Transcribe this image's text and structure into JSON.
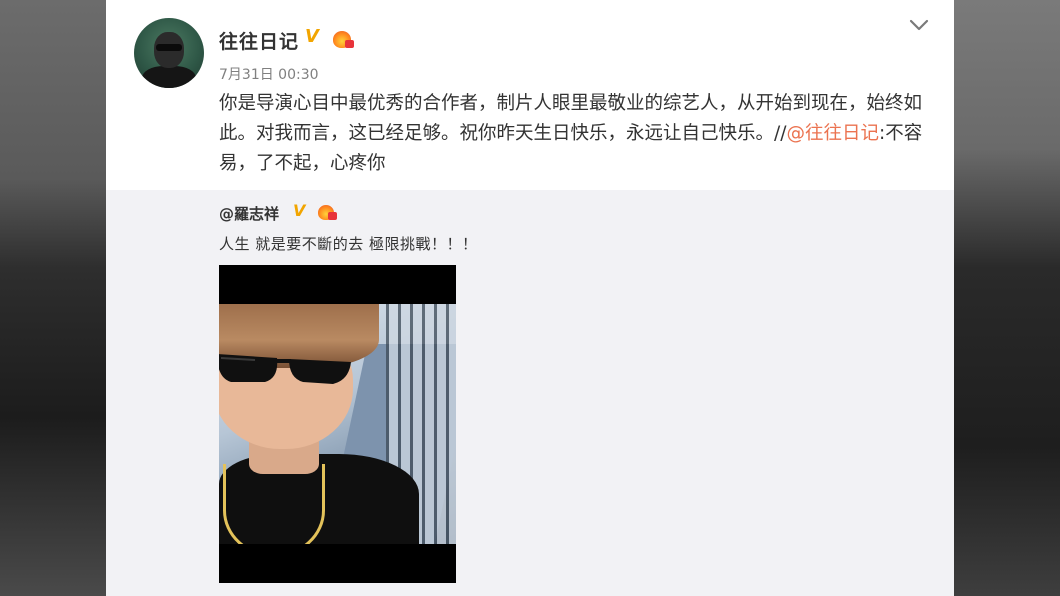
{
  "post": {
    "username": "往往日记",
    "timestamp": "7月31日 00:30",
    "verified_badge": "V",
    "text_main": "你是导演心目中最优秀的合作者，制片人眼里最敬业的综艺人，从开始到现在，始终如此。对我而言，这已经足够。祝你昨天生日快乐，永远让自己快乐。//",
    "mention": "@往往日记",
    "text_tail": ":不容易，了不起，心疼你"
  },
  "repost": {
    "username": "@羅志祥",
    "verified_badge": "V",
    "text": "人生 就是要不斷的去 極限挑戰！！！"
  },
  "icons": {
    "menu": "chevron-down-icon",
    "verified": "verified-v-icon",
    "fire": "fire-badge-icon"
  },
  "colors": {
    "mention": "#eb7350",
    "verified": "#f2a500",
    "text": "#333333",
    "meta": "#808080",
    "repost_bg": "#f2f2f5"
  }
}
